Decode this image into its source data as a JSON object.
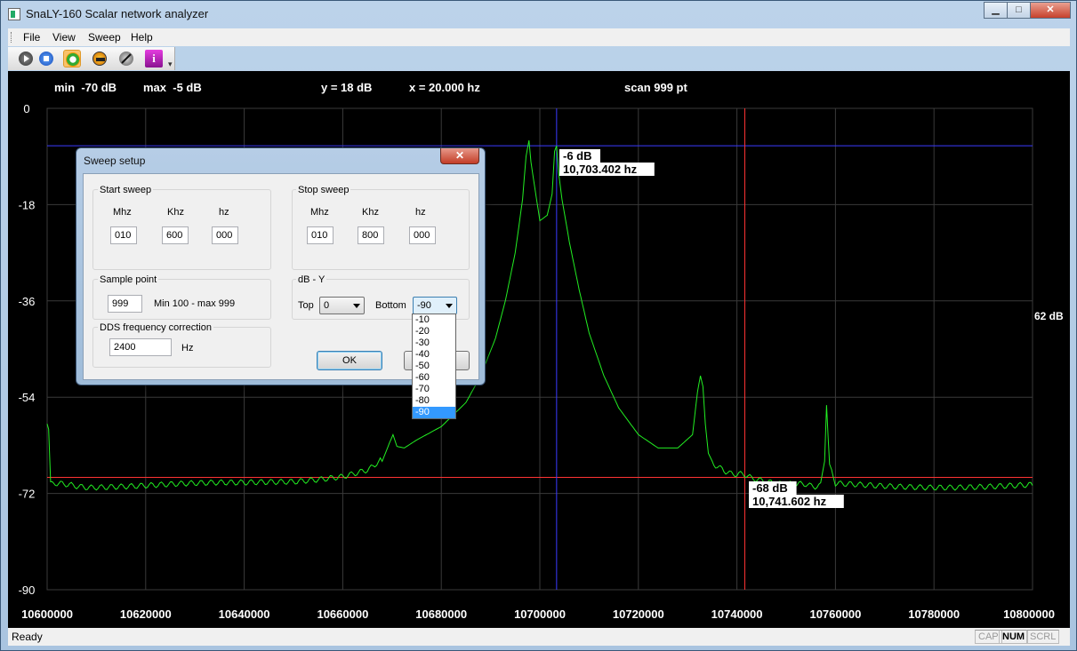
{
  "window": {
    "title": "SnaLY-160 Scalar network analyzer",
    "minimize_glyph": "▁",
    "maximize_glyph": "□",
    "close_glyph": "✕"
  },
  "menu": {
    "file": "File",
    "view": "View",
    "sweep": "Sweep",
    "help": "Help"
  },
  "toolbar": {
    "icons": [
      "play-icon",
      "stop-icon",
      "gear-icon",
      "display-icon",
      "tool-icon",
      "info-icon"
    ],
    "info_glyph": "i"
  },
  "readouts": {
    "min": "min  -70 dB",
    "max": "max  -5 dB",
    "y": "y = 18 dB",
    "x": "x = 20.000 hz",
    "scan": "scan 999 pt",
    "right_label": "62 dB"
  },
  "marker1": {
    "db": "-6 dB",
    "freq": "10,703.402 hz"
  },
  "marker2": {
    "db": "-68 dB",
    "freq": "10,741.602 hz"
  },
  "status": {
    "ready": "Ready",
    "cap": "CAP",
    "num": "NUM",
    "scrl": "SCRL"
  },
  "dialog": {
    "title": "Sweep setup",
    "close_glyph": "✕",
    "start_sweep": {
      "label": "Start sweep",
      "mhz_label": "Mhz",
      "khz_label": "Khz",
      "hz_label": "hz",
      "mhz": "010",
      "khz": "600",
      "hz": "000"
    },
    "stop_sweep": {
      "label": "Stop sweep",
      "mhz_label": "Mhz",
      "khz_label": "Khz",
      "hz_label": "hz",
      "mhz": "010",
      "khz": "800",
      "hz": "000"
    },
    "sample_point": {
      "label": "Sample point",
      "value": "999",
      "range": "Min 100 - max 999"
    },
    "db_y": {
      "label": "dB - Y",
      "top_label": "Top",
      "top_value": "0",
      "bottom_label": "Bottom",
      "bottom_value": "-90",
      "options": [
        "-10",
        "-20",
        "-30",
        "-40",
        "-50",
        "-60",
        "-70",
        "-80",
        "-90"
      ],
      "selected_index": 8
    },
    "dds": {
      "label": "DDS frequency correction",
      "value": "2400",
      "unit": "Hz"
    },
    "ok": "OK"
  },
  "chart_data": {
    "type": "line",
    "ylim": [
      -90,
      0
    ],
    "xlim": [
      10600000,
      10800000
    ],
    "y_ticks": [
      "0",
      "-18",
      "-36",
      "-54",
      "-72",
      "-90"
    ],
    "x_ticks": [
      "10600000",
      "10620000",
      "10640000",
      "10660000",
      "10680000",
      "10700000",
      "10720000",
      "10740000",
      "10760000",
      "10780000",
      "10800000"
    ],
    "grid": true,
    "colors": {
      "trace": "#22ee22",
      "grid": "#3a3a3a",
      "hline_top": "#3a3aff",
      "hline_bottom": "#ff3333",
      "vline1": "#3a3aff",
      "vline2": "#ff3333"
    },
    "hline_top_db": -7,
    "hline_bottom_db": -69,
    "vline1_x": 10703402,
    "vline2_x": 10741602,
    "series": [
      {
        "x": [
          10600000,
          10600300,
          10600700,
          10602000,
          10610000,
          10620000,
          10630000,
          10640000,
          10650000,
          10655000,
          10660000,
          10665000,
          10668000,
          10669500,
          10670200,
          10671000,
          10672500,
          10675000,
          10680000,
          10685000,
          10688000,
          10691000,
          10693000,
          10695000,
          10696500,
          10697200,
          10697800,
          10698200,
          10699000,
          10700000,
          10701500,
          10702500,
          10703000,
          10703400,
          10703800,
          10704500,
          10706000,
          10708000,
          10710000,
          10713000,
          10716000,
          10720000,
          10724000,
          10728000,
          10731000,
          10732000,
          10732600,
          10733100,
          10733600,
          10734200,
          10735000,
          10737000,
          10740000,
          10743000,
          10748000,
          10754000,
          10757000,
          10757800,
          10758200,
          10758800,
          10760000,
          10770000,
          10780000,
          10790000,
          10800000
        ],
        "y": [
          -59,
          -60,
          -70,
          -70.5,
          -70.5,
          -70.5,
          -70.4,
          -70.3,
          -69.8,
          -69.2,
          -68.5,
          -67.2,
          -66,
          -62.5,
          -61,
          -63.2,
          -63.5,
          -62,
          -59.5,
          -55,
          -50,
          -43,
          -36,
          -27,
          -17,
          -9,
          -6,
          -10,
          -15,
          -21,
          -20,
          -16,
          -8,
          -7,
          -12,
          -17,
          -25,
          -34,
          -42,
          -50,
          -56,
          -61,
          -63.5,
          -63.5,
          -61,
          -53,
          -50,
          -52,
          -59,
          -64.5,
          -66,
          -67.2,
          -68.5,
          -69.2,
          -70,
          -70.3,
          -70.3,
          -66,
          -55.5,
          -67,
          -70.4,
          -70.5,
          -70.5,
          -70.5,
          -70.5
        ]
      }
    ]
  }
}
